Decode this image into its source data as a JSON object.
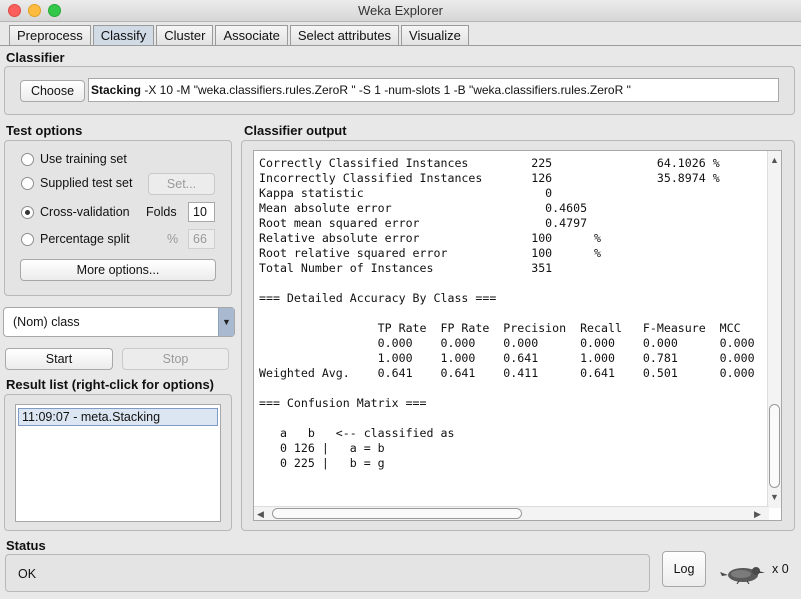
{
  "window": {
    "title": "Weka Explorer"
  },
  "tabs": [
    {
      "label": "Preprocess"
    },
    {
      "label": "Classify"
    },
    {
      "label": "Cluster"
    },
    {
      "label": "Associate"
    },
    {
      "label": "Select attributes"
    },
    {
      "label": "Visualize"
    }
  ],
  "classifier": {
    "section_label": "Classifier",
    "choose_label": "Choose",
    "name": "Stacking",
    "options": " -X 10 -M \"weka.classifiers.rules.ZeroR \" -S 1 -num-slots 1 -B \"weka.classifiers.rules.ZeroR \""
  },
  "test_options": {
    "section_label": "Test options",
    "use_training_set": "Use training set",
    "supplied_test_set": "Supplied test set",
    "set_button": "Set...",
    "cross_validation": "Cross-validation",
    "folds_label": "Folds",
    "folds_value": "10",
    "percentage_split": "Percentage split",
    "percent_symbol": "%",
    "percent_value": "66",
    "more_options": "More options...",
    "selected": "Cross-validation"
  },
  "class_select": {
    "value": "(Nom) class"
  },
  "actions": {
    "start": "Start",
    "stop": "Stop"
  },
  "result_list": {
    "section_label": "Result list (right-click for options)",
    "items": [
      "11:09:07 - meta.Stacking"
    ]
  },
  "output": {
    "section_label": "Classifier output",
    "text": "Correctly Classified Instances         225               64.1026 %\nIncorrectly Classified Instances       126               35.8974 %\nKappa statistic                          0     \nMean absolute error                      0.4605\nRoot mean squared error                  0.4797\nRelative absolute error                100      %\nRoot relative squared error            100      %\nTotal Number of Instances              351     \n\n=== Detailed Accuracy By Class ===\n\n                 TP Rate  FP Rate  Precision  Recall   F-Measure  MCC\n                 0.000    0.000    0.000      0.000    0.000      0.000\n                 1.000    1.000    0.641      1.000    0.781      0.000\nWeighted Avg.    0.641    0.641    0.411      0.641    0.501      0.000\n\n=== Confusion Matrix ===\n\n   a   b   <-- classified as\n   0 126 |   a = b\n   0 225 |   b = g"
  },
  "status": {
    "section_label": "Status",
    "text": "OK",
    "log_button": "Log",
    "task_count": "x 0"
  }
}
